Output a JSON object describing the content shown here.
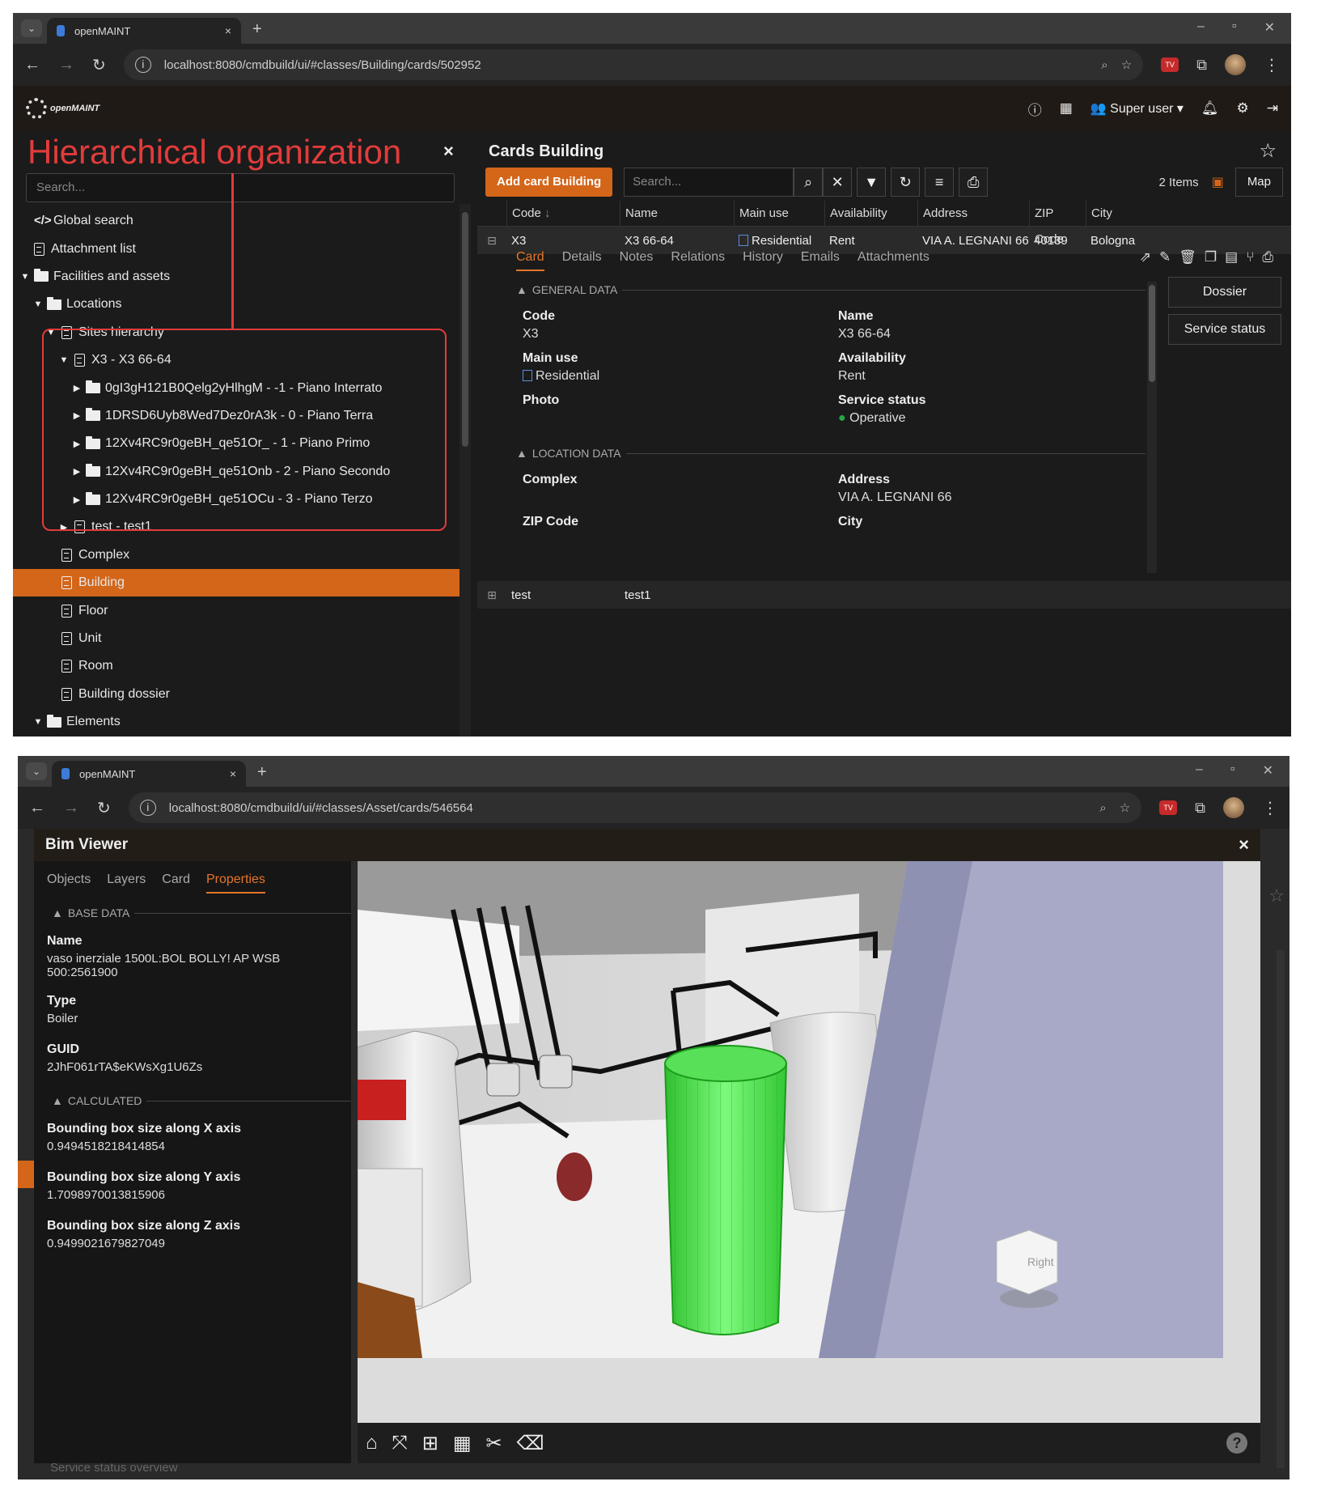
{
  "top": {
    "browser": {
      "tab_title": "openMAINT",
      "tab_close": "×",
      "new_tab": "+",
      "url": "localhost:8080/cmdbuild/ui/#classes/Building/cards/502952"
    },
    "app": {
      "logo_text": "openMAINT",
      "user": "Super user"
    },
    "annotation": {
      "title": "Hierarchical organization",
      "close": "×"
    },
    "nav": {
      "search_placeholder": "Search...",
      "items": [
        {
          "label": "Global search"
        },
        {
          "label": "Attachment list"
        },
        {
          "label": "Facilities and assets"
        },
        {
          "label": "Locations"
        },
        {
          "label": "Sites hierarchy"
        },
        {
          "label": "X3 - X3 66-64"
        },
        {
          "label": "0gI3gH121B0Qelg2yHlhgM - -1 - Piano Interrato"
        },
        {
          "label": "1DRSD6Uyb8Wed7Dez0rA3k - 0 - Piano Terra"
        },
        {
          "label": "12Xv4RC9r0geBH_qe51Or_ - 1 - Piano Primo"
        },
        {
          "label": "12Xv4RC9r0geBH_qe51Onb - 2 - Piano Secondo"
        },
        {
          "label": "12Xv4RC9r0geBH_qe51OCu - 3 - Piano Terzo"
        },
        {
          "label": "test - test1"
        },
        {
          "label": "Complex"
        },
        {
          "label": "Building"
        },
        {
          "label": "Floor"
        },
        {
          "label": "Unit"
        },
        {
          "label": "Room"
        },
        {
          "label": "Building dossier"
        },
        {
          "label": "Elements"
        }
      ]
    },
    "cards": {
      "title": "Cards Building",
      "add_button": "Add card Building",
      "search_placeholder": "Search...",
      "items_count": "2 Items",
      "map_button": "Map",
      "columns": [
        "Code",
        "Name",
        "Main use",
        "Availability",
        "Address",
        "ZIP Code",
        "City"
      ],
      "row1": {
        "code": "X3",
        "name": "X3 66-64",
        "main_use": "Residential",
        "availability": "Rent",
        "address": "VIA A. LEGNANI 66",
        "zip": "40139",
        "city": "Bologna"
      },
      "row2": {
        "code": "test",
        "name": "test1"
      },
      "detail_tabs": [
        "Card",
        "Details",
        "Notes",
        "Relations",
        "History",
        "Emails",
        "Attachments"
      ],
      "general_data": "GENERAL DATA",
      "location_data": "LOCATION DATA",
      "fields": {
        "code_label": "Code",
        "code_value": "X3",
        "name_label": "Name",
        "name_value": "X3 66-64",
        "main_use_label": "Main use",
        "main_use_value": "Residential",
        "availability_label": "Availability",
        "availability_value": "Rent",
        "photo_label": "Photo",
        "service_status_label": "Service status",
        "service_status_value": "Operative",
        "complex_label": "Complex",
        "address_label": "Address",
        "address_value": "VIA A. LEGNANI 66",
        "zip_label": "ZIP Code",
        "city_label": "City"
      },
      "side_buttons": [
        "Dossier",
        "Service status"
      ]
    }
  },
  "bottom": {
    "browser": {
      "tab_title": "openMAINT",
      "tab_close": "×",
      "new_tab": "+",
      "url": "localhost:8080/cmdbuild/ui/#classes/Asset/cards/546564"
    },
    "bim": {
      "title": "Bim Viewer",
      "close": "×",
      "tabs": [
        "Objects",
        "Layers",
        "Card",
        "Properties"
      ],
      "base_data": "BASE DATA",
      "calculated": "CALCULATED",
      "name_label": "Name",
      "name_value": "vaso inerziale 1500L:BOL BOLLY! AP WSB 500:2561900",
      "type_label": "Type",
      "type_value": "Boiler",
      "guid_label": "GUID",
      "guid_value": "2JhF061rTA$eKWsXg1U6Zs",
      "bbx_label": "Bounding box size along X axis",
      "bbx_value": "0.9494518218414854",
      "bby_label": "Bounding box size along Y axis",
      "bby_value": "1.7098970013815906",
      "bbz_label": "Bounding box size along Z axis",
      "bbz_value": "0.9499021679827049",
      "navcube_label": "Right",
      "peek_text": "Service status overview"
    }
  },
  "colors": {
    "accent": "#d4661a",
    "annotation": "#e23b3b",
    "selected_object": "#3fd43f",
    "status_ok": "#28a745"
  }
}
